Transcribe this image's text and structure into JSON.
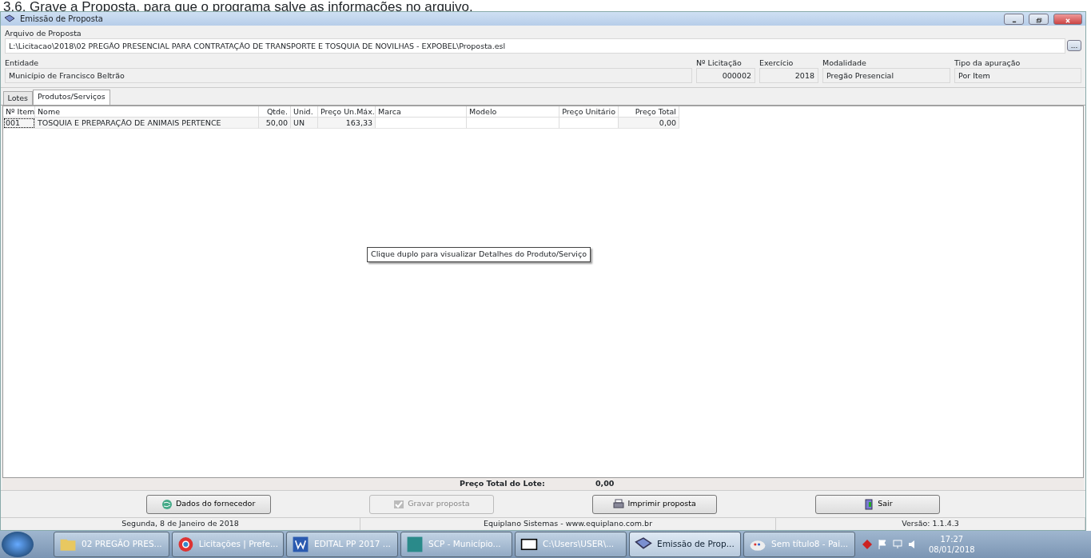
{
  "document_heading": "3.6. Grave a Proposta, para que o programa salve as informações no arquivo.",
  "window": {
    "title": "Emissão de Proposta"
  },
  "file_field": {
    "label": "Arquivo de Proposta",
    "value": "L:\\Licitacao\\2018\\02 PREGÃO PRESENCIAL PARA CONTRATAÇÃO DE TRANSPORTE E TOSQUIA DE NOVILHAS - EXPOBEL\\Proposta.esl",
    "browse": "..."
  },
  "info_fields": [
    {
      "label": "Entidade",
      "value": "Município de Francisco Beltrão"
    },
    {
      "label": "Nº Licitação",
      "value": "000002"
    },
    {
      "label": "Exercício",
      "value": "2018"
    },
    {
      "label": "Modalidade",
      "value": "Pregão Presencial"
    },
    {
      "label": "Tipo da apuração",
      "value": "Por Item"
    }
  ],
  "tabs": [
    {
      "label": "Lotes",
      "selected": false
    },
    {
      "label": "Produtos/Serviços",
      "selected": true
    }
  ],
  "table": {
    "columns": [
      "Nº Item",
      "Nome",
      "Qtde.",
      "Unid.",
      "Preço Un.Máx.",
      "Marca",
      "Modelo",
      "Preço Unitário",
      "Preço Total"
    ],
    "rows": [
      [
        "001",
        "TOSQUIA E PREPARAÇÃO DE ANIMAIS PERTENCE",
        "50,00",
        "UN",
        "163,33",
        "",
        "",
        "",
        "0,00"
      ]
    ]
  },
  "tooltip": "Clique duplo para visualizar Detalhes do Produto/Serviço",
  "total": {
    "label": "Preço Total do Lote:",
    "value": "0,00"
  },
  "buttons": [
    {
      "label": "Dados do fornecedor",
      "disabled": false
    },
    {
      "label": "Gravar proposta",
      "disabled": true
    },
    {
      "label": "Imprimir proposta",
      "disabled": false
    },
    {
      "label": "Sair",
      "disabled": false
    }
  ],
  "status_bar": [
    "Segunda, 8 de Janeiro de 2018",
    "Equiplano Sistemas - www.equiplano.com.br",
    "Versão: 1.1.4.3"
  ],
  "taskbar": {
    "items": [
      {
        "label": "02 PREGÃO PRES...",
        "selected": false
      },
      {
        "label": "Licitações | Prefe...",
        "selected": false
      },
      {
        "label": "EDITAL PP 2017 ...",
        "selected": false
      },
      {
        "label": "SCP - Município...",
        "selected": false
      },
      {
        "label": "C:\\Users\\USER\\...",
        "selected": false
      },
      {
        "label": "Emissão de Prop...",
        "selected": true
      },
      {
        "label": "Sem título8 - Pai...",
        "selected": false
      }
    ],
    "time": "17:27",
    "date": "08/01/2018"
  }
}
